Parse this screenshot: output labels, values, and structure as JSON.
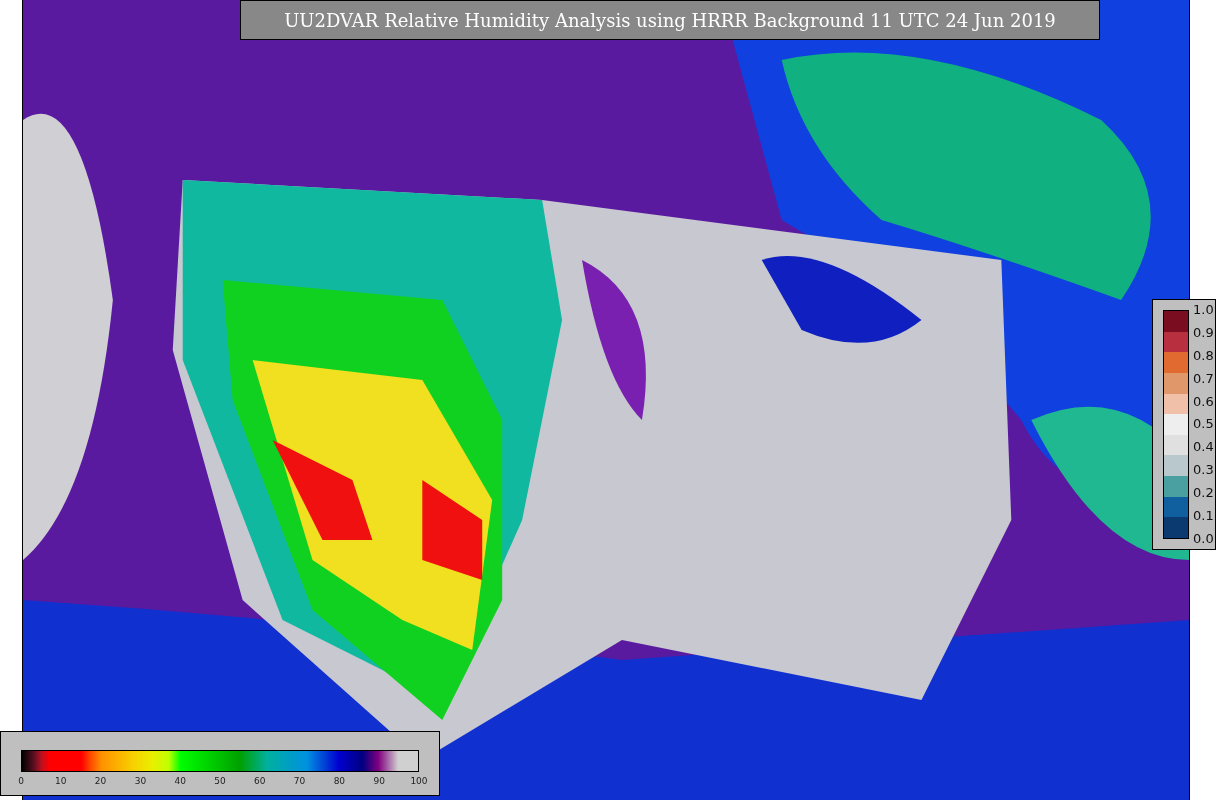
{
  "title": "UU2DVAR Relative Humidity Analysis using HRRR Background 11 UTC 24 Jun 2019",
  "observation_legend": {
    "ticks": [
      "1.0",
      "0.9",
      "0.8",
      "0.7",
      "0.6",
      "0.5",
      "0.4",
      "0.3",
      "0.2",
      "0.1",
      "0.0"
    ]
  },
  "humidity_legend": {
    "ticks": [
      "0",
      "10",
      "20",
      "30",
      "40",
      "50",
      "60",
      "70",
      "80",
      "90",
      "100"
    ]
  }
}
